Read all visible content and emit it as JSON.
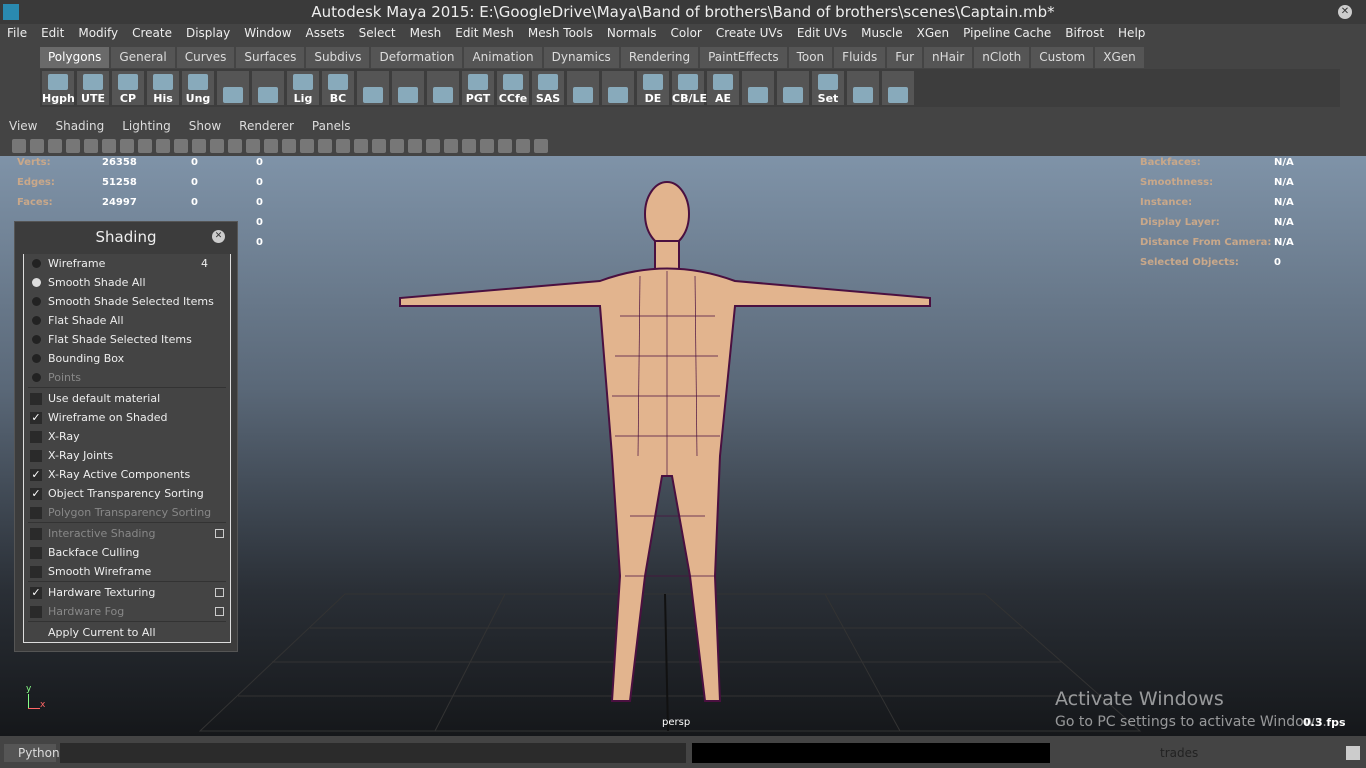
{
  "title": "Autodesk Maya 2015: E:\\GoogleDrive\\Maya\\Band of brothers\\Band of brothers\\scenes\\Captain.mb*",
  "menu": [
    "File",
    "Edit",
    "Modify",
    "Create",
    "Display",
    "Window",
    "Assets",
    "Select",
    "Mesh",
    "Edit Mesh",
    "Mesh Tools",
    "Normals",
    "Color",
    "Create UVs",
    "Edit UVs",
    "Muscle",
    "XGen",
    "Pipeline Cache",
    "Bifrost",
    "Help"
  ],
  "shelf_tabs": [
    "Polygons",
    "General",
    "Curves",
    "Surfaces",
    "Subdivs",
    "Deformation",
    "Animation",
    "Dynamics",
    "Rendering",
    "PaintEffects",
    "Toon",
    "Fluids",
    "Fur",
    "nHair",
    "nCloth",
    "Custom",
    "XGen"
  ],
  "shelf_icons": [
    "Hgph",
    "UTE",
    "CP",
    "His",
    "Ung",
    "",
    "",
    "Lig",
    "BC",
    "",
    "",
    "",
    "PGT",
    "CCfe",
    "SAS",
    "",
    "",
    "DE",
    "CB/LE",
    "AE",
    "",
    "",
    "Set",
    "",
    ""
  ],
  "panel_menu": [
    "View",
    "Shading",
    "Lighting",
    "Show",
    "Renderer",
    "Panels"
  ],
  "hud_left": [
    {
      "k": "Verts:",
      "v": [
        "26358",
        "0",
        "0"
      ]
    },
    {
      "k": "Edges:",
      "v": [
        "51258",
        "0",
        "0"
      ]
    },
    {
      "k": "Faces:",
      "v": [
        "24997",
        "0",
        "0"
      ]
    }
  ],
  "hud_left_extra": [
    "0",
    "0"
  ],
  "hud_right": [
    {
      "k": "Backfaces:",
      "v": "N/A"
    },
    {
      "k": "Smoothness:",
      "v": "N/A"
    },
    {
      "k": "Instance:",
      "v": "N/A"
    },
    {
      "k": "Display Layer:",
      "v": "N/A"
    },
    {
      "k": "Distance From Camera:",
      "v": "N/A"
    },
    {
      "k": "Selected Objects:",
      "v": "0"
    }
  ],
  "shading": {
    "title": "Shading",
    "radios": [
      {
        "label": "Wireframe",
        "num": "4",
        "on": false
      },
      {
        "label": "Smooth Shade All",
        "on": true
      },
      {
        "label": "Smooth Shade Selected Items"
      },
      {
        "label": "Flat Shade All"
      },
      {
        "label": "Flat Shade Selected Items"
      },
      {
        "label": "Bounding Box"
      },
      {
        "label": "Points",
        "dis": true
      }
    ],
    "checks1": [
      {
        "label": "Use default material"
      },
      {
        "label": "Wireframe on Shaded",
        "c": true
      },
      {
        "label": "X-Ray"
      },
      {
        "label": "X-Ray Joints"
      },
      {
        "label": "X-Ray Active Components",
        "c": true
      },
      {
        "label": "Object Transparency Sorting",
        "c": true
      },
      {
        "label": "Polygon Transparency Sorting",
        "dis": true
      }
    ],
    "checks2": [
      {
        "label": "Interactive Shading",
        "dis": true,
        "opt": true
      },
      {
        "label": "Backface Culling"
      },
      {
        "label": "Smooth Wireframe"
      }
    ],
    "checks3": [
      {
        "label": "Hardware Texturing",
        "c": true,
        "opt": true
      },
      {
        "label": "Hardware Fog",
        "dis": true,
        "opt": true
      }
    ],
    "apply": "Apply Current to All"
  },
  "camera": "persp",
  "fps": "0.3 fps",
  "watermark": {
    "line1": "Activate Windows",
    "line2": "Go to PC settings to activate Windows."
  },
  "cmd": {
    "lang": "Python",
    "tab": "trades"
  },
  "axis": {
    "y": "y",
    "x": "x"
  }
}
